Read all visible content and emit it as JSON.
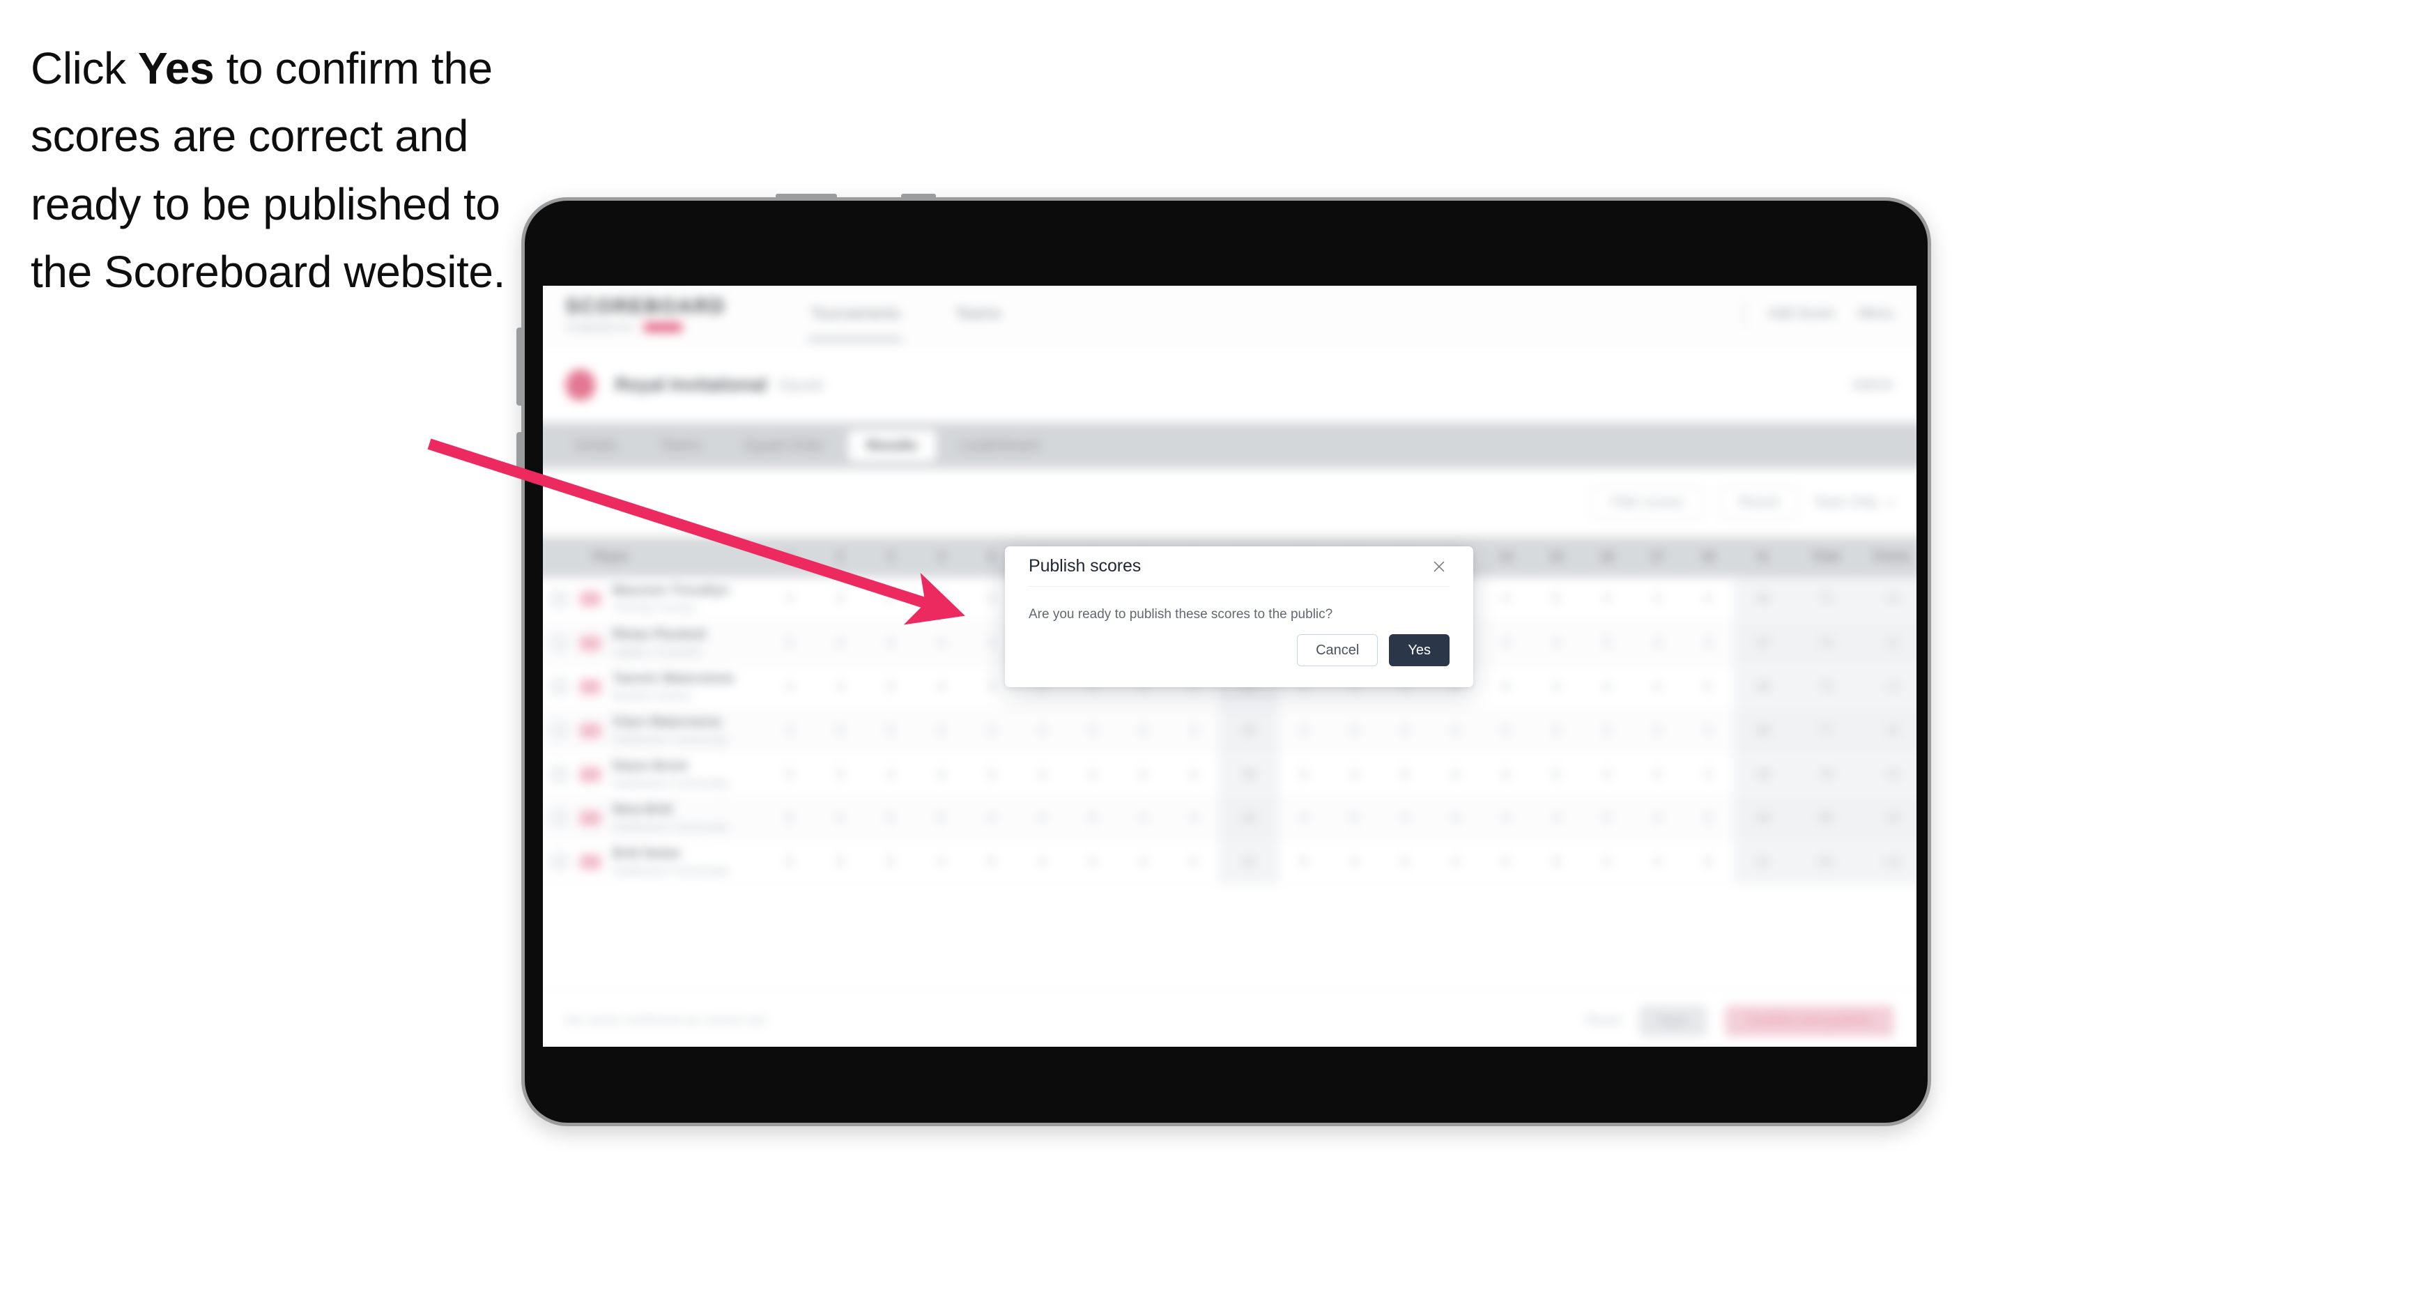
{
  "caption": {
    "before": "Click ",
    "emphasis": "Yes",
    "after": " to confirm the scores are correct and ready to be published to the Scoreboard website."
  },
  "annotation": {
    "arrow_color": "#ED2A5F",
    "points_to": "yes-button"
  },
  "device": {
    "type": "tablet",
    "body_color": "#0C0C0C",
    "bezel_color": "#9B9C9E"
  },
  "app": {
    "header": {
      "brand": "SCOREBOARD",
      "brand_sub": "POWERED BY",
      "nav": [
        {
          "label": "Tournaments",
          "active": true
        },
        {
          "label": "Teams",
          "active": false
        }
      ],
      "right": [
        {
          "label": "Add Score"
        },
        {
          "label": "Menu"
        }
      ]
    },
    "tournament": {
      "name": "Royal Invitational",
      "meta": "Squad",
      "right": "Admin"
    },
    "tabs": [
      {
        "label": "Details",
        "active": false
      },
      {
        "label": "Teams",
        "active": false
      },
      {
        "label": "Squad Order",
        "active": false
      },
      {
        "label": "Results",
        "active": true
      },
      {
        "label": "Leaderboard",
        "active": false
      }
    ],
    "filters": {
      "left_control": "Filter scores",
      "right_controls": [
        {
          "label": "Round"
        },
        {
          "label": "Team Only"
        }
      ]
    },
    "table": {
      "columns": [
        "Player",
        "1",
        "2",
        "3",
        "4",
        "5",
        "6",
        "7",
        "8",
        "9",
        "Out",
        "10",
        "11",
        "12",
        "13",
        "14",
        "15",
        "16",
        "17",
        "18",
        "In",
        "Total",
        "Points"
      ],
      "rows": [
        {
          "name": "Maureen Trevallyn",
          "club": "Thornby Country",
          "scores": [
            "4",
            "5",
            "4",
            "3",
            "5",
            "4",
            "4",
            "3",
            "4",
            "36",
            "4",
            "5",
            "3",
            "4",
            "4",
            "5",
            "4",
            "3",
            "4",
            "36",
            "72",
            "+0"
          ],
          "total": "72",
          "points": "+0"
        },
        {
          "name": "Rhian Plunkett",
          "club": "Ingleby Cresswell",
          "scores": [
            "5",
            "4",
            "4",
            "4",
            "4",
            "4",
            "5",
            "3",
            "4",
            "37",
            "4",
            "4",
            "4",
            "5",
            "3",
            "4",
            "5",
            "4",
            "4",
            "37",
            "74",
            "+2"
          ],
          "total": "74",
          "points": "+2"
        },
        {
          "name": "Tamsin Waterstone",
          "club": "Bracken Downs",
          "scores": [
            "4",
            "4",
            "5",
            "4",
            "4",
            "5",
            "4",
            "4",
            "3",
            "37",
            "5",
            "4",
            "4",
            "4",
            "4",
            "4",
            "4",
            "4",
            "5",
            "38",
            "75",
            "+3"
          ],
          "total": "75",
          "points": "+3"
        },
        {
          "name": "Clare Waterstone",
          "club": "Hartlemere Community",
          "scores": [
            "4",
            "5",
            "5",
            "4",
            "4",
            "4",
            "5",
            "4",
            "4",
            "39",
            "4",
            "5",
            "4",
            "4",
            "5",
            "4",
            "4",
            "4",
            "4",
            "38",
            "77",
            "+5"
          ],
          "total": "77",
          "points": "+5"
        },
        {
          "name": "Diane Brent",
          "club": "Hartlemere Community",
          "scores": [
            "5",
            "5",
            "4",
            "4",
            "5",
            "4",
            "4",
            "4",
            "4",
            "39",
            "5",
            "4",
            "5",
            "4",
            "4",
            "5",
            "4",
            "4",
            "4",
            "39",
            "78",
            "+6"
          ],
          "total": "78",
          "points": "+6"
        },
        {
          "name": "Nina Britt",
          "club": "Hartlemere Community",
          "scores": [
            "5",
            "4",
            "5",
            "5",
            "4",
            "4",
            "5",
            "4",
            "4",
            "40",
            "4",
            "5",
            "4",
            "5",
            "4",
            "4",
            "5",
            "4",
            "5",
            "40",
            "80",
            "+8"
          ],
          "total": "80",
          "points": "+8"
        },
        {
          "name": "Britt Nolan",
          "club": "Hartlemere Community",
          "scores": [
            "5",
            "5",
            "5",
            "4",
            "5",
            "4",
            "5",
            "4",
            "5",
            "42",
            "5",
            "4",
            "5",
            "4",
            "5",
            "5",
            "4",
            "4",
            "5",
            "41",
            "83",
            "+11"
          ],
          "total": "83",
          "points": "+11"
        }
      ]
    },
    "bottom_bar": {
      "status": "No cards confirmed as correct yet",
      "link": "Reset",
      "grey_button": "Save",
      "pink_button": "Confirm and publish"
    }
  },
  "modal": {
    "title": "Publish scores",
    "message": "Are you ready to publish these scores to the public?",
    "cancel_label": "Cancel",
    "confirm_label": "Yes",
    "close_icon": "close-icon",
    "confirm_color": "#2B3648"
  }
}
